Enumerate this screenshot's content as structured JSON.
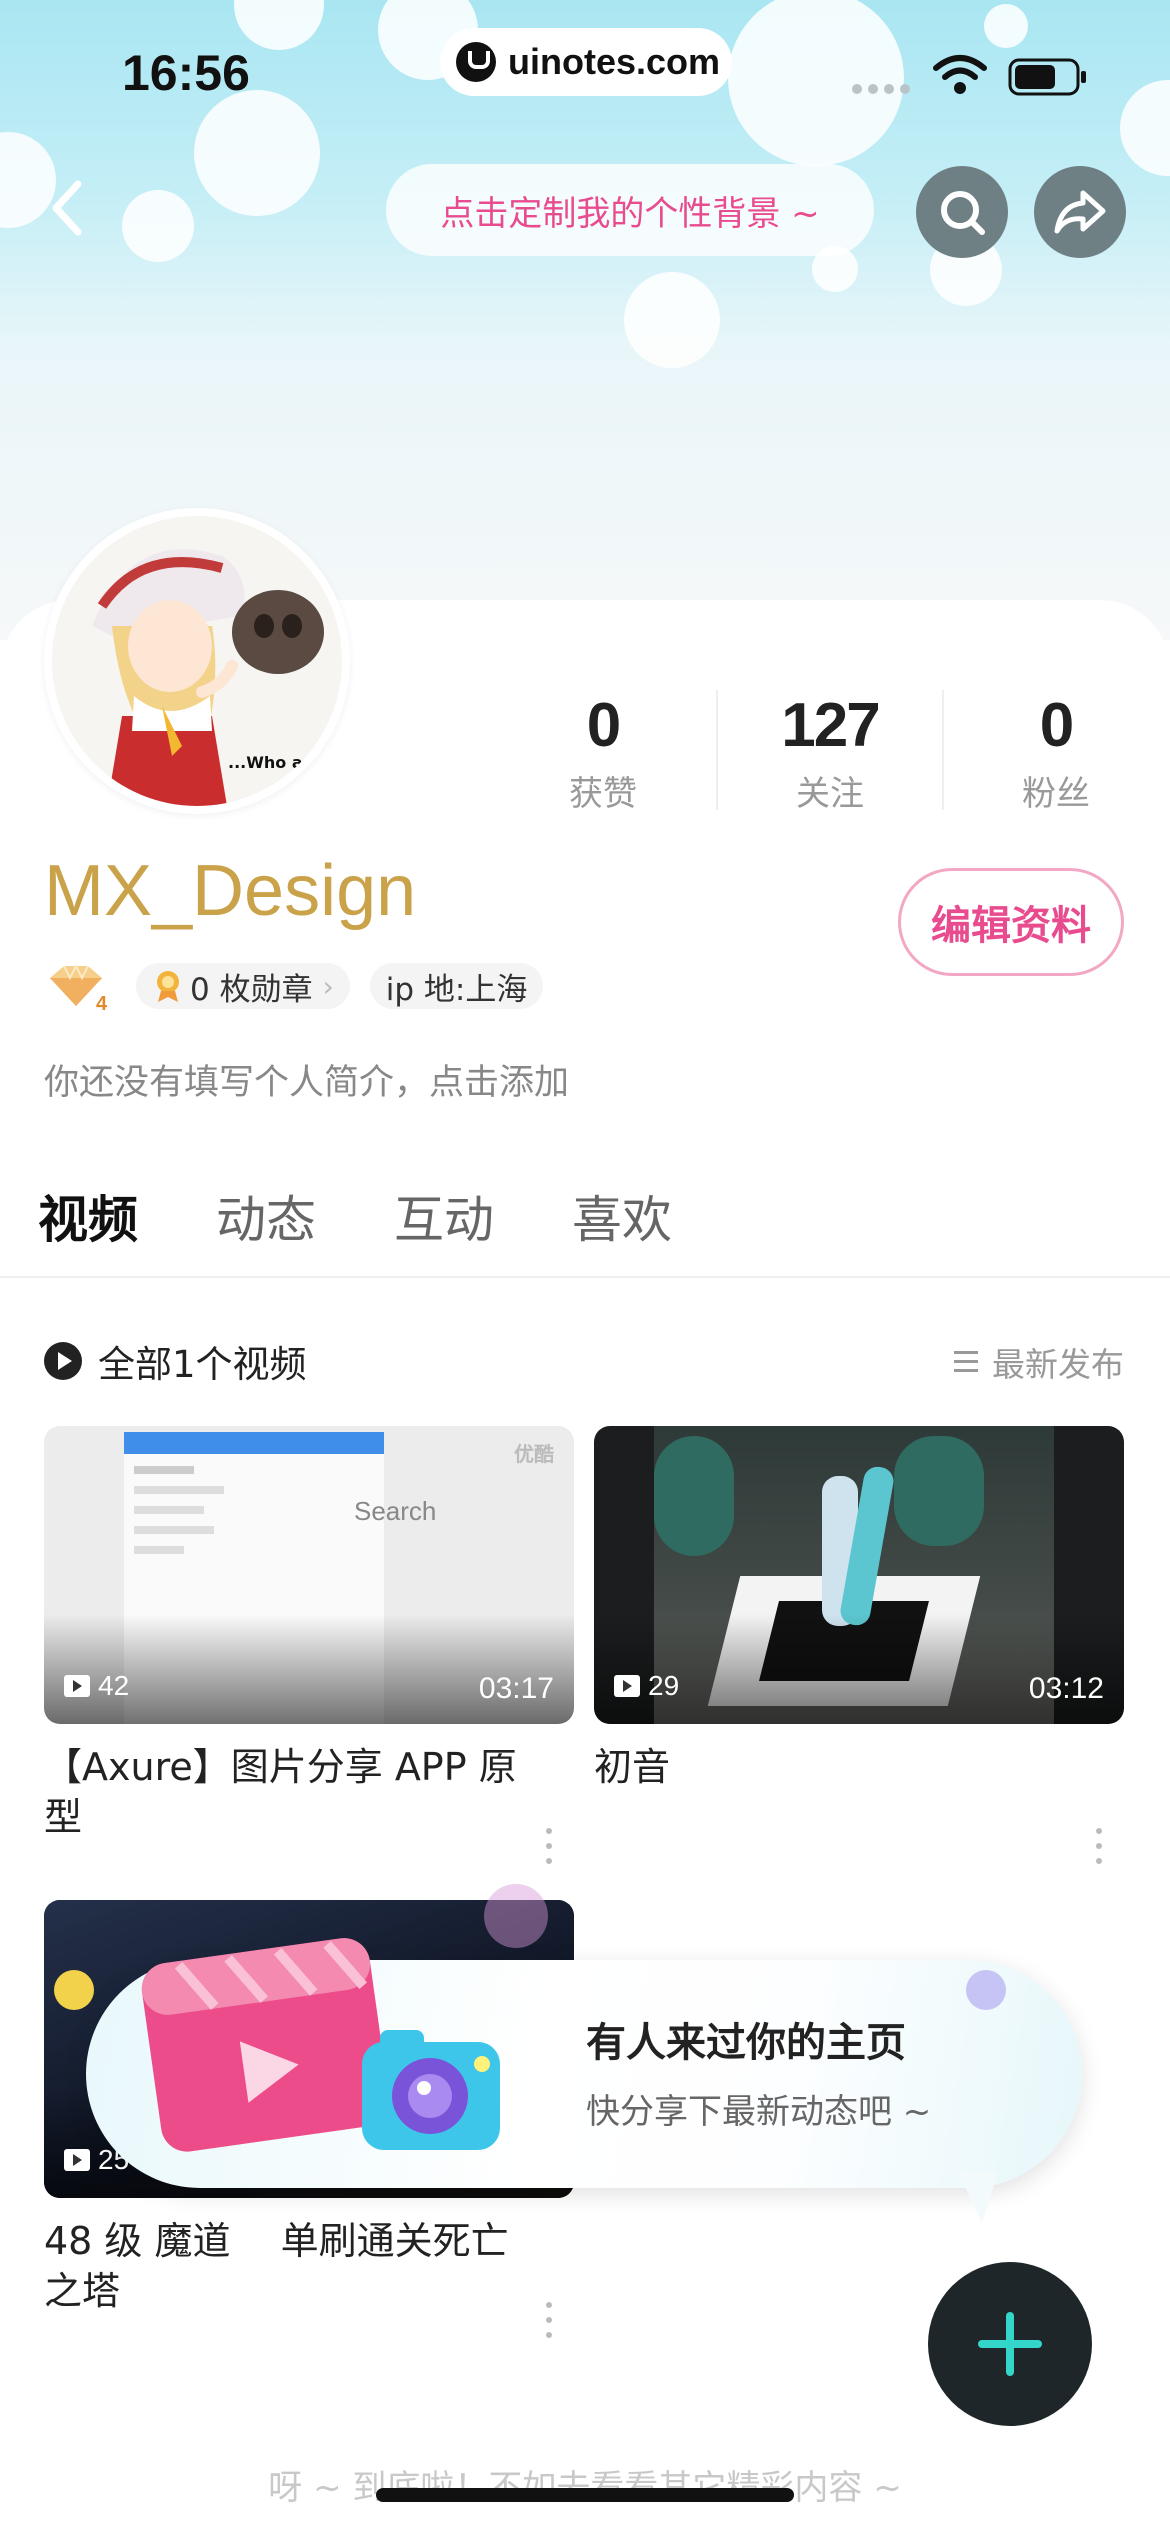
{
  "status_bar": {
    "time": "16:56",
    "url": "uinotes.com"
  },
  "header": {
    "customize_label": "点击定制我的个性背景 ~",
    "icons": [
      "back-icon",
      "search-icon",
      "share-icon"
    ]
  },
  "profile": {
    "username": "MX_Design",
    "edit_label": "编辑资料",
    "level": "4",
    "medals_label": "0 枚勋章",
    "ip_label": "ip 地:上海",
    "bio": "你还没有填写个人简介，点击添加",
    "avatar_caption": "...Who are y",
    "stats": [
      {
        "value": "0",
        "label": "获赞"
      },
      {
        "value": "127",
        "label": "关注"
      },
      {
        "value": "0",
        "label": "粉丝"
      }
    ]
  },
  "tabs": [
    {
      "label": "视频",
      "active": true
    },
    {
      "label": "动态",
      "active": false
    },
    {
      "label": "互动",
      "active": false
    },
    {
      "label": "喜欢",
      "active": false
    }
  ],
  "section": {
    "title": "全部1个视频",
    "sort_label": "最新发布"
  },
  "videos": [
    {
      "title": "【Axure】图片分享 APP 原型",
      "plays": "42",
      "duration": "03:17",
      "thumb_text": "Search",
      "watermark": "优酷"
    },
    {
      "title": "初音",
      "plays": "29",
      "duration": "03:12"
    },
    {
      "title": "48 级 魔道　 单刷通关死亡之塔",
      "plays": "25"
    }
  ],
  "popup": {
    "title": "有人来过你的主页",
    "subtitle": "快分享下最新动态吧 ~"
  },
  "footer": {
    "text": "呀 ~ 到底啦！不如去看看其它精彩内容 ~"
  },
  "colors": {
    "accent_pink": "#e84c8f",
    "username_gold": "#c9a24a",
    "fab_plus": "#33d6c8"
  }
}
